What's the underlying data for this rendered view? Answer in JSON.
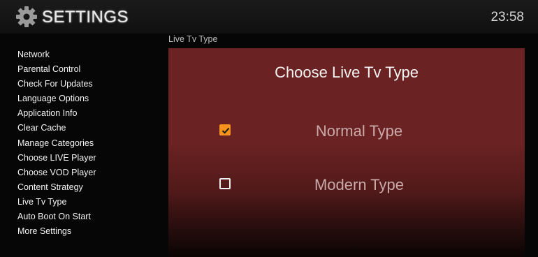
{
  "header": {
    "title": "SETTINGS",
    "icon": "gear-icon",
    "time": "23:58"
  },
  "sidebar": {
    "items": [
      {
        "label": "Network"
      },
      {
        "label": "Parental Control"
      },
      {
        "label": "Check For Updates"
      },
      {
        "label": "Language Options"
      },
      {
        "label": "Application Info"
      },
      {
        "label": "Clear Cache"
      },
      {
        "label": "Manage Categories"
      },
      {
        "label": "Choose LIVE Player"
      },
      {
        "label": "Choose VOD Player"
      },
      {
        "label": "Content Strategy"
      },
      {
        "label": "Live Tv Type"
      },
      {
        "label": "Auto Boot On Start"
      },
      {
        "label": "More Settings"
      }
    ]
  },
  "main": {
    "section_label": "Live Tv Type",
    "dialog_title": "Choose Live Tv Type",
    "options": [
      {
        "label": "Normal Type",
        "checked": true
      },
      {
        "label": "Modern Type",
        "checked": false
      }
    ]
  },
  "colors": {
    "accent": "#f5931e",
    "panel": "#6b2222",
    "background": "#060606"
  }
}
